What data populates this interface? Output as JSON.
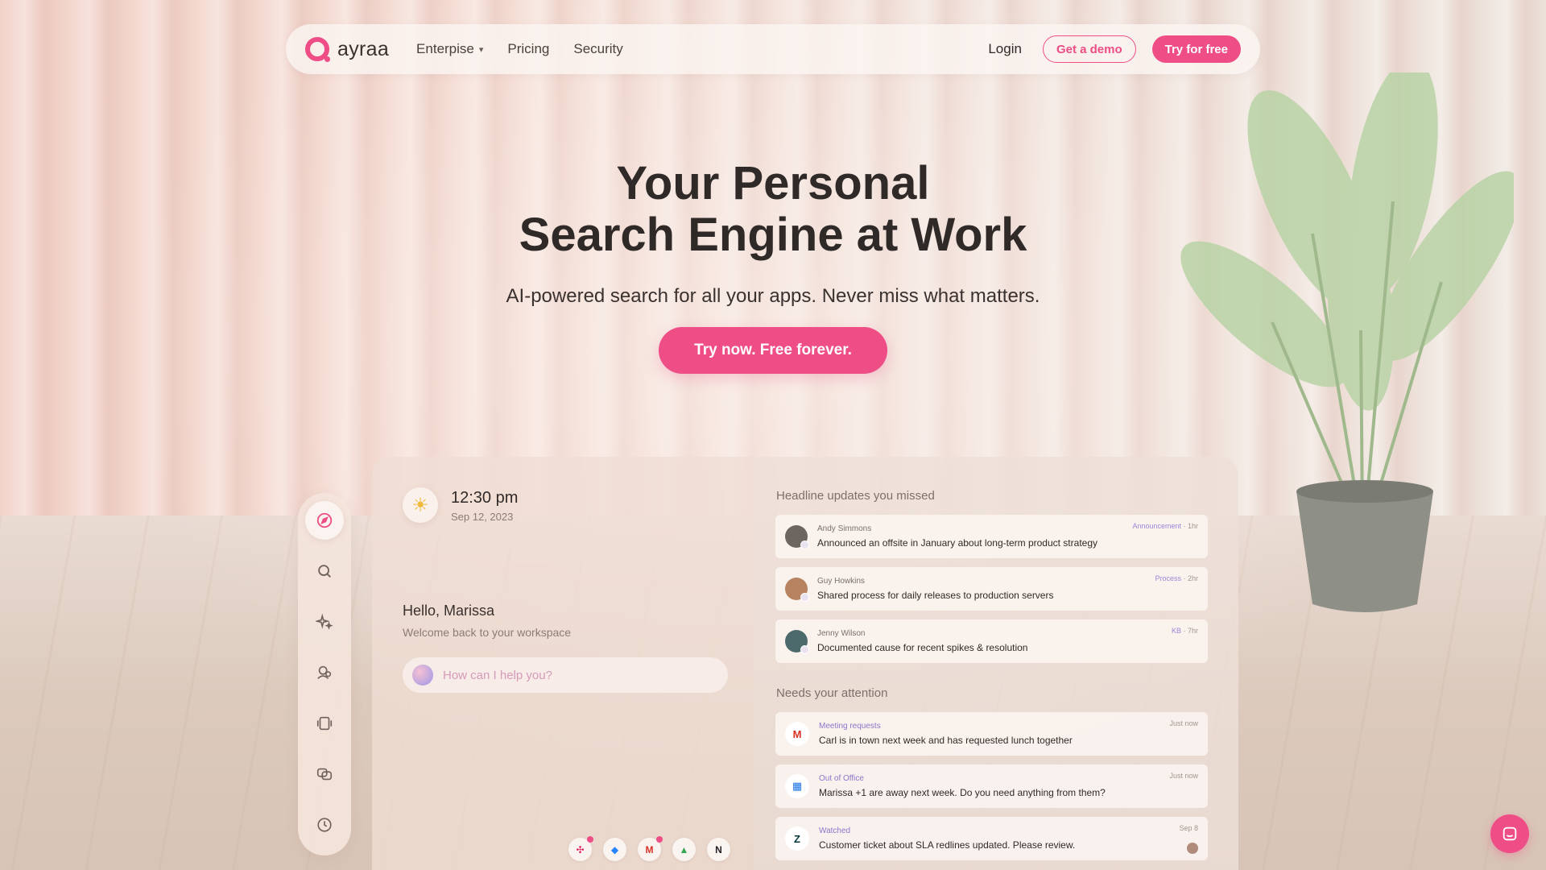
{
  "brand": {
    "name": "ayraa",
    "accent": "#ee4d86"
  },
  "nav": {
    "links": [
      {
        "label": "Enterpise",
        "has_dropdown": true
      },
      {
        "label": "Pricing"
      },
      {
        "label": "Security"
      }
    ],
    "login": "Login",
    "demo": "Get a demo",
    "try": "Try for free"
  },
  "hero": {
    "title_line1": "Your Personal",
    "title_line2": "Search Engine at Work",
    "subtitle": "AI-powered search for all your apps. Never miss what matters.",
    "cta": "Try now. Free forever."
  },
  "sidebar": {
    "icons": [
      "compass-icon",
      "search-icon",
      "sparkles-icon",
      "people-icon",
      "device-icon",
      "layers-icon",
      "history-icon"
    ]
  },
  "workspace": {
    "time": "12:30 pm",
    "date": "Sep 12, 2023",
    "greeting": "Hello, Marissa",
    "welcome": "Welcome back to your workspace",
    "ask_placeholder": "How can I help you?",
    "apps": [
      {
        "name": "slack-icon",
        "glyph": "✣",
        "notify": true
      },
      {
        "name": "jira-icon",
        "glyph": "◆",
        "notify": false
      },
      {
        "name": "gmail-icon",
        "glyph": "M",
        "notify": true
      },
      {
        "name": "drive-icon",
        "glyph": "▲",
        "notify": false
      },
      {
        "name": "notion-icon",
        "glyph": "N",
        "notify": false
      }
    ]
  },
  "headlines": {
    "title": "Headline updates you missed",
    "items": [
      {
        "person": "Andy Simmons",
        "type": "Announcement",
        "age": "1hr",
        "text": "Announced an offsite in January about long-term product strategy"
      },
      {
        "person": "Guy Howkins",
        "type": "Process",
        "age": "2hr",
        "text": "Shared process for daily releases to production servers"
      },
      {
        "person": "Jenny Wilson",
        "type": "KB",
        "age": "7hr",
        "text": "Documented cause for recent spikes & resolution"
      }
    ]
  },
  "attention": {
    "title": "Needs your attention",
    "items": [
      {
        "service": "gmail-icon",
        "glyph": "M",
        "tag": "Meeting requests",
        "age": "Just now",
        "text": "Carl is in town next week and has requested lunch together"
      },
      {
        "service": "calendar-icon",
        "glyph": "▦",
        "tag": "Out of Office",
        "age": "Just now",
        "text": "Marissa +1 are away next week. Do you need anything from them?"
      },
      {
        "service": "zendesk-icon",
        "glyph": "Z",
        "tag": "Watched",
        "age": "Sep 8",
        "text": "Customer ticket about SLA redlines updated. Please review."
      }
    ]
  }
}
